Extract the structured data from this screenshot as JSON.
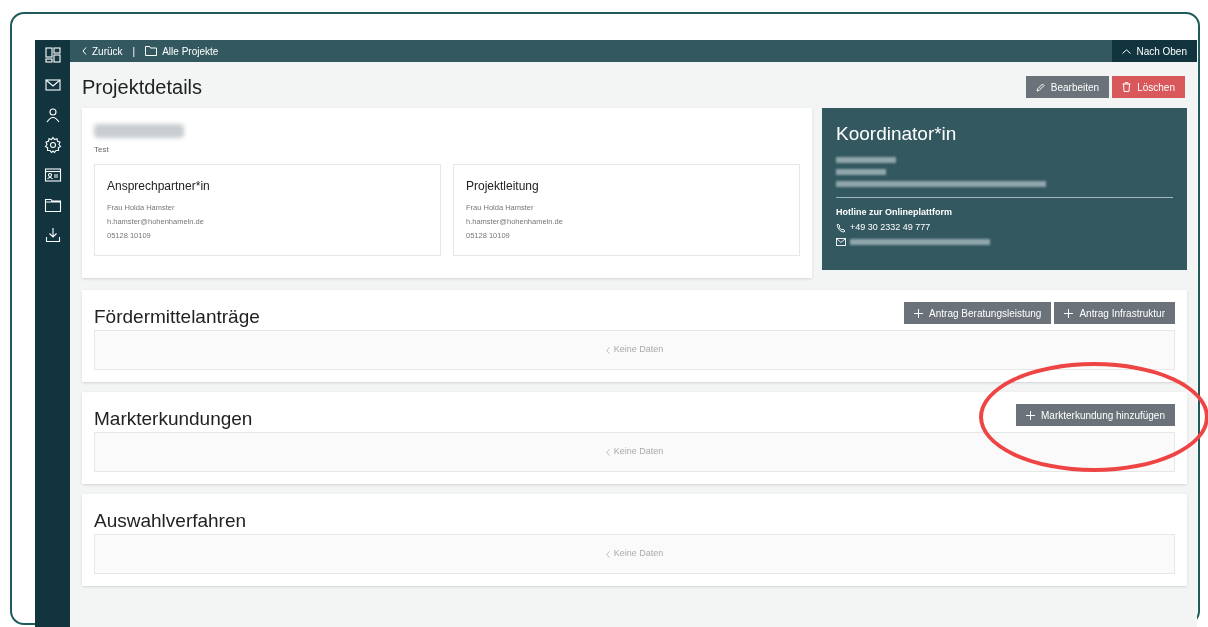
{
  "sidebar": {
    "items": [
      {
        "kind": "dashboard"
      },
      {
        "kind": "mail"
      },
      {
        "kind": "person"
      },
      {
        "kind": "settings"
      },
      {
        "kind": "idcard"
      },
      {
        "kind": "folder"
      },
      {
        "kind": "download"
      }
    ]
  },
  "topbar": {
    "back": "Zurück",
    "separator": "|",
    "all_projects": "Alle Projekte",
    "to_top": "Nach Oben"
  },
  "page": {
    "title": "Projektdetails",
    "buttons": [
      {
        "kind": "edit",
        "label": "Bearbeiten"
      },
      {
        "kind": "delete",
        "label": "Löschen"
      }
    ]
  },
  "project": {
    "subtitle": "Test",
    "contacts": [
      {
        "title": "Ansprechpartner*in",
        "lines": [
          "Frau Holda Hamster",
          "h.hamster@hohenhameln.de",
          "05128 10109"
        ]
      },
      {
        "title": "Projektleitung",
        "lines": [
          "Frau Holda Hamster",
          "h.hamster@hohenhameln.de",
          "05128 10109"
        ]
      }
    ]
  },
  "coordinator": {
    "title": "Koordinator*in",
    "hotline_title": "Hotline zur Onlineplattform",
    "hotline_phone": "+49 30 2332 49 777"
  },
  "sections": [
    {
      "title": "Fördermittelanträge",
      "buttons": [
        "Antrag Beratungsleistung",
        "Antrag Infrastruktur"
      ],
      "empty": "Keine Daten",
      "highlighted": false
    },
    {
      "title": "Markterkundungen",
      "buttons": [
        "Markterkundung hinzufügen"
      ],
      "empty": "Keine Daten",
      "highlighted": true
    },
    {
      "title": "Auswahlverfahren",
      "empty": "Keine Daten",
      "highlighted": false
    }
  ]
}
